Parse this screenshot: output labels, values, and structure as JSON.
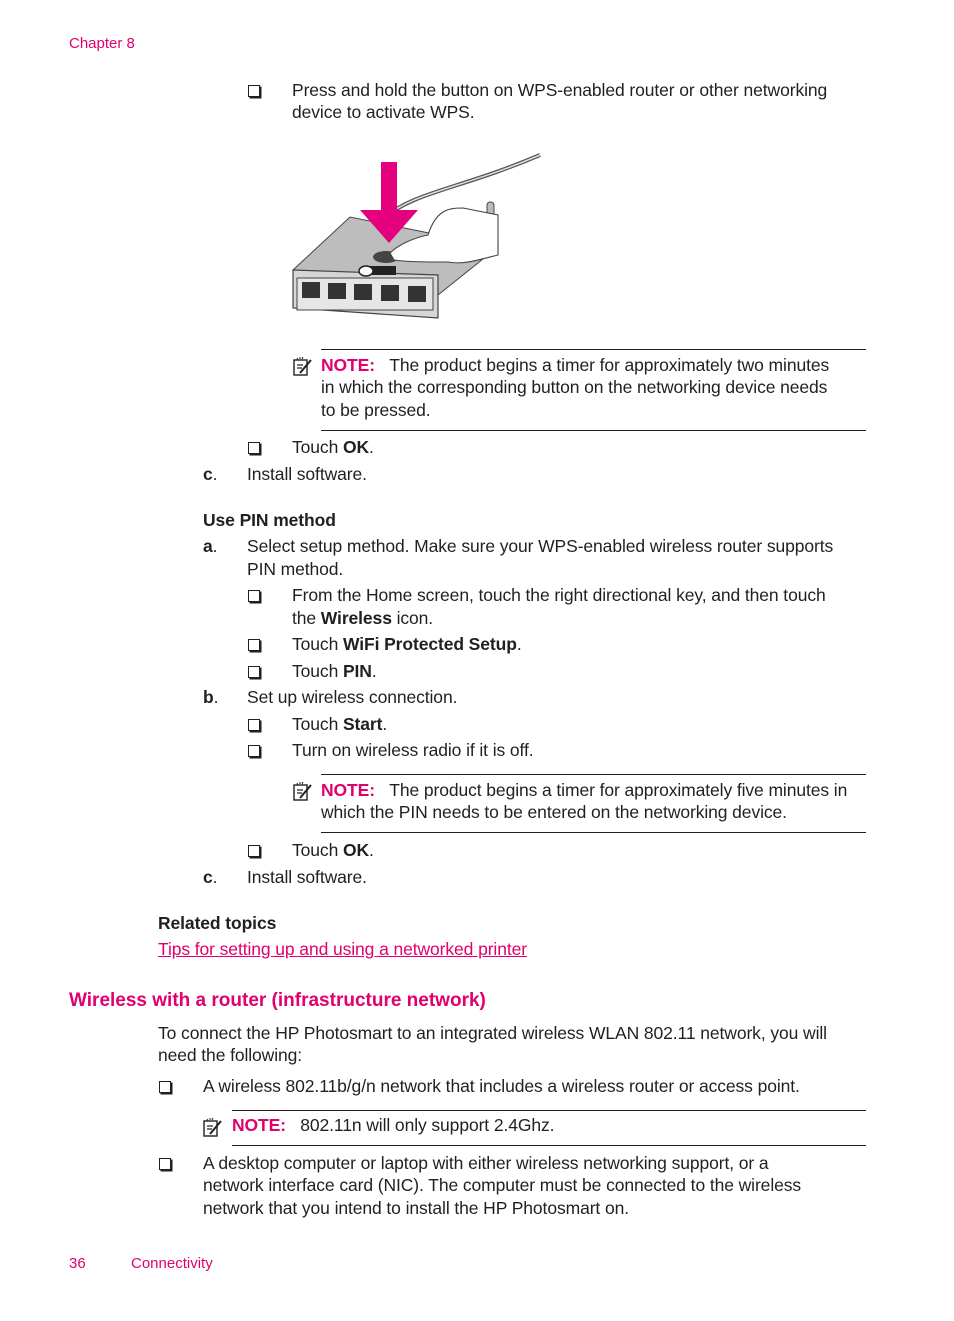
{
  "header": {
    "chapter": "Chapter 8"
  },
  "footer": {
    "page_number": "36",
    "section": "Connectivity"
  },
  "colors": {
    "accent": "#e0006e",
    "text": "#231f20"
  },
  "wps_button": {
    "step1": "Press and hold the button on WPS-enabled router or other networking",
    "step1_cont": "device to activate WPS.",
    "figure": {
      "icon": "router-wps-button-press-illustration"
    },
    "note": {
      "icon": "note-icon",
      "label": "NOTE:",
      "line1": "The product begins a timer for approximately two minutes",
      "line2": "in which the corresponding button on the networking device needs",
      "line3": "to be pressed."
    },
    "step2_prefix": "Touch ",
    "step2_bold": "OK",
    "step2_suffix": ".",
    "c_marker": "c",
    "c_text": "Install software."
  },
  "pin_method": {
    "heading": "Use PIN method",
    "a_marker": "a",
    "a_line1": "Select setup method. Make sure your WPS-enabled wireless router supports",
    "a_line2": "PIN method.",
    "a_items": [
      {
        "line1": "From the Home screen, touch the right directional key, and then touch",
        "line2_prefix": "the ",
        "line2_bold": "Wireless",
        "line2_suffix": " icon."
      },
      {
        "prefix": "Touch ",
        "bold": "WiFi Protected Setup",
        "suffix": "."
      },
      {
        "prefix": "Touch ",
        "bold": "PIN",
        "suffix": "."
      }
    ],
    "b_marker": "b",
    "b_text": "Set up wireless connection.",
    "b_items": [
      {
        "prefix": "Touch ",
        "bold": "Start",
        "suffix": "."
      },
      {
        "text": "Turn on wireless radio if it is off."
      }
    ],
    "note": {
      "label": "NOTE:",
      "line1": "The product begins a timer for approximately five minutes in",
      "line2": "which the PIN needs to be entered on the networking device."
    },
    "b_last": {
      "prefix": "Touch ",
      "bold": "OK",
      "suffix": "."
    },
    "c_marker": "c",
    "c_text": "Install software."
  },
  "related": {
    "heading": "Related topics",
    "link": "Tips for setting up and using a networked printer"
  },
  "infrastructure": {
    "heading": "Wireless with a router (infrastructure network)",
    "intro_line1": "To connect the HP Photosmart to an integrated wireless WLAN 802.11 network, you will",
    "intro_line2": "need the following:",
    "item1": "A wireless 802.11b/g/n network that includes a wireless router or access point.",
    "note": {
      "label": "NOTE:",
      "text": "802.11n will only support 2.4Ghz."
    },
    "item2_line1": "A desktop computer or laptop with either wireless networking support, or a",
    "item2_line2": "network interface card (NIC). The computer must be connected to the wireless",
    "item2_line3": "network that you intend to install the HP Photosmart on."
  }
}
